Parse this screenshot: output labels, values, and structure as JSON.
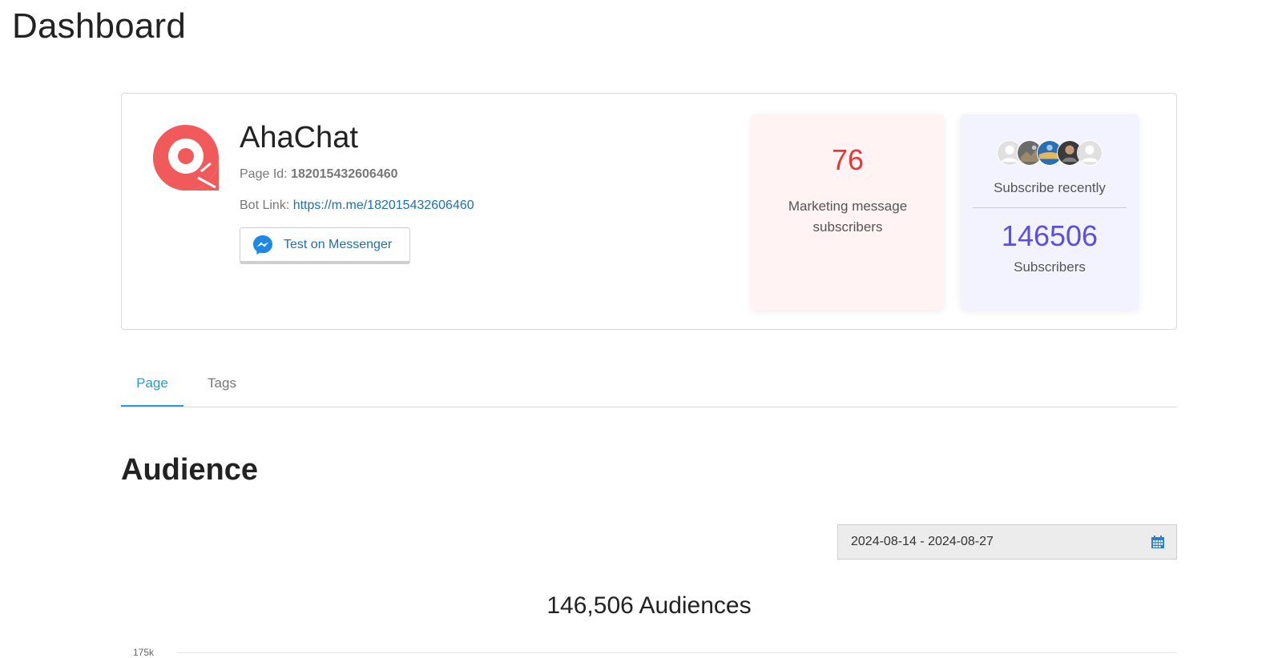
{
  "page_title": "Dashboard",
  "page_card": {
    "name": "AhaChat",
    "page_id_label": "Page Id: ",
    "page_id_value": "182015432606460",
    "bot_link_label": "Bot Link: ",
    "bot_link_value": "https://m.me/182015432606460",
    "messenger_button_label": "Test on Messenger",
    "logo_icon": "ahachat-logo-icon",
    "brand_color": "#f05a5b"
  },
  "stats": {
    "marketing": {
      "value": "76",
      "label_line1": "Marketing message",
      "label_line2": "subscribers",
      "value_color": "#e53935"
    },
    "subscribers": {
      "recent_label": "Subscribe recently",
      "value": "146506",
      "label": "Subscribers",
      "value_color": "#5a4fe0",
      "avatars": [
        "avatar-placeholder",
        "avatar-photo",
        "avatar-photo",
        "avatar-photo",
        "avatar-placeholder"
      ]
    }
  },
  "tabs": [
    {
      "label": "Page",
      "active": true
    },
    {
      "label": "Tags",
      "active": false
    }
  ],
  "audience": {
    "title": "Audience",
    "date_range": "2024-08-14 - 2024-08-27",
    "count_text": "146,506 Audiences",
    "first_tick": "175k"
  },
  "colors": {
    "tab_active": "#2b9ad2",
    "link": "#1e6fb5",
    "messenger_blue": "#1e88e5"
  }
}
